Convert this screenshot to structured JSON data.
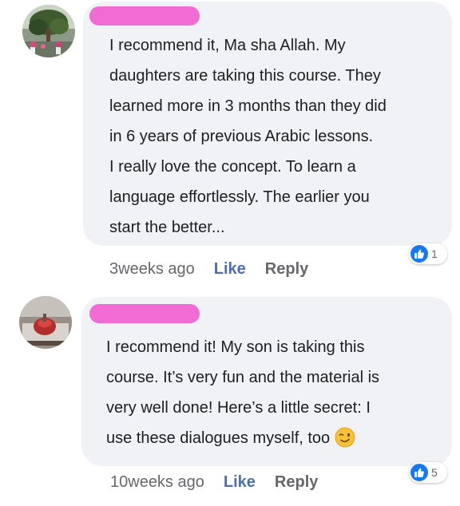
{
  "comments": [
    {
      "lines": [
        "I recommend it, Ma sha Allah. My",
        "daughters are taking this course. They",
        "learned more in 3 months than they did",
        "in 6 years of previous Arabic lessons.",
        "I really love the concept. To learn a",
        "language effortlessly. The earlier you",
        "start the better..."
      ],
      "time": "3weeks ago",
      "like_label": "Like",
      "reply_label": "Reply",
      "reaction_icon": "thumbs-up-icon",
      "reaction_count": "1"
    },
    {
      "lines": [
        "I recommend it! My son is taking this",
        "course. It’s very fun and the material is",
        "very well done! Here’s a little secret: I",
        "use these dialogues myself, too"
      ],
      "emoji": "winking-face-emoji",
      "time": "10weeks ago",
      "like_label": "Like",
      "reply_label": "Reply",
      "reaction_icon": "thumbs-up-icon",
      "reaction_count": "5"
    }
  ],
  "colors": {
    "bubble": "#f0f2f5",
    "redaction": "#f06bd3",
    "like": "#4a6fb5",
    "meta": "#65676b",
    "reaction": "#1877f2"
  }
}
